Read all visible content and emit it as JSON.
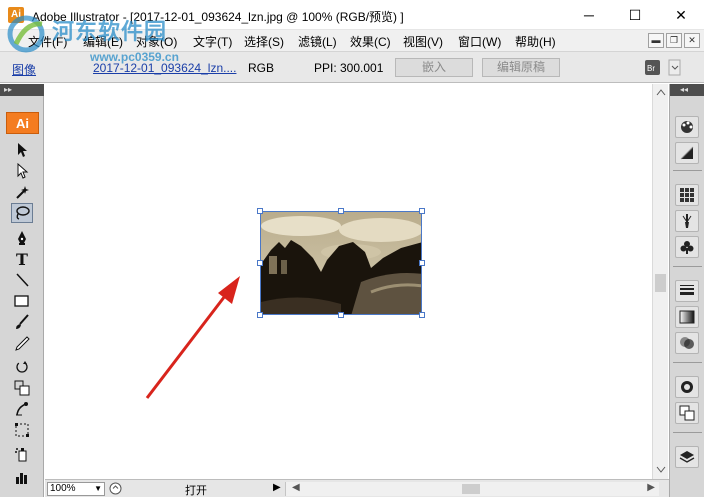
{
  "window": {
    "title": "Adobe Illustrator - [2017-12-01_093624_lzn.jpg @ 100% (RGB/预览) ]",
    "app_icon": "Ai",
    "minimize_glyph": "─",
    "maximize_glyph": "☐",
    "close_glyph": "✕"
  },
  "menu": {
    "items": [
      "文件(F)",
      "编辑(E)",
      "对象(O)",
      "文字(T)",
      "选择(S)",
      "滤镜(L)",
      "效果(C)",
      "视图(V)",
      "窗口(W)",
      "帮助(H)"
    ],
    "mdi_min": "▬",
    "mdi_restore": "❐",
    "mdi_close": "✕"
  },
  "watermark": {
    "title": "河东软件园",
    "url": "www.pc0359.cn"
  },
  "control_bar": {
    "kind": "图像",
    "filename": "2017-12-01_093624_lzn....",
    "color_mode": "RGB",
    "ppi": "PPI: 300.001",
    "embed_button": "嵌入",
    "edit_original_button": "编辑原稿"
  },
  "toolbox": {
    "collapse_glyph": "▸▸",
    "logo": "Ai"
  },
  "right_dock": {
    "collapse_glyph": "◂◂"
  },
  "status_bar": {
    "zoom": "100%",
    "action": "打开",
    "arrow": "▶",
    "scroll_left": "◀",
    "scroll_right": "▶"
  },
  "colors": {
    "accent_orange": "#f47c20",
    "selection_blue": "#4a78c8",
    "arrow_red": "#d8241c"
  }
}
